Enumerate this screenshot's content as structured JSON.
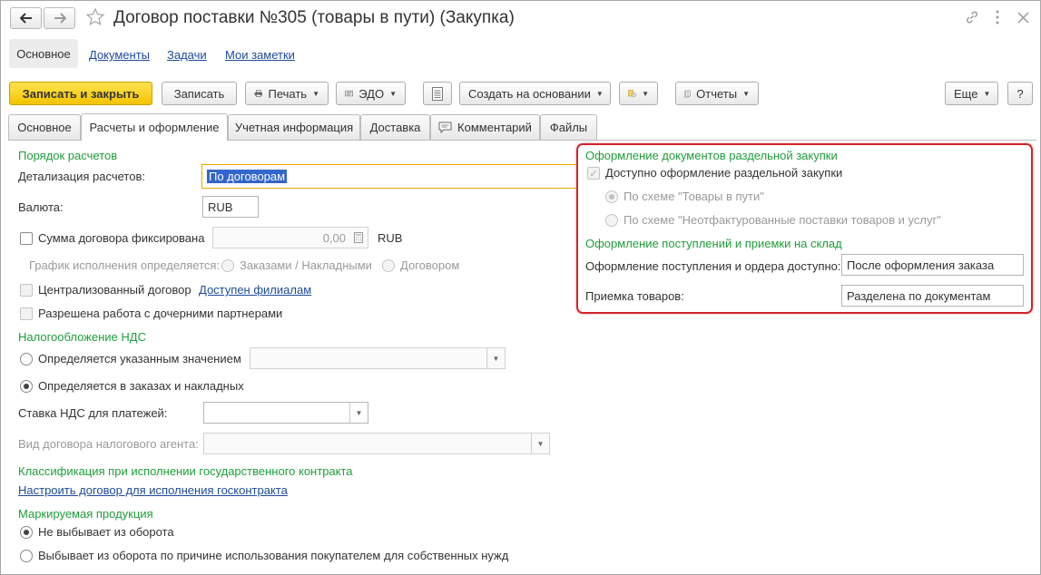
{
  "header": {
    "title": "Договор поставки №305 (товары в пути) (Закупка)",
    "back_icon": "arrow-left",
    "forward_icon": "arrow-right",
    "favorite_icon": "star",
    "link_icon": "chain-link",
    "more_icon": "vertical-dots",
    "close_icon": "close-x"
  },
  "nav": {
    "main": "Основное",
    "documents": "Документы",
    "tasks": "Задачи",
    "notes": "Мои заметки"
  },
  "toolbar": {
    "save_close": "Записать и закрыть",
    "save": "Записать",
    "print": "Печать",
    "edo": "ЭДО",
    "create_based": "Создать на основании",
    "reports": "Отчеты",
    "more": "Еще",
    "help": "?"
  },
  "tabs": [
    {
      "label": "Основное"
    },
    {
      "label": "Расчеты и оформление"
    },
    {
      "label": "Учетная информация"
    },
    {
      "label": "Доставка"
    },
    {
      "label": "Комментарий"
    },
    {
      "label": "Файлы"
    }
  ],
  "left": {
    "section_payment": "Порядок расчетов",
    "detail_label": "Детализация расчетов:",
    "detail_value": "По договорам",
    "currency_label": "Валюта:",
    "currency_value": "RUB",
    "fixed_sum_label": "Сумма договора фиксирована",
    "fixed_sum_value": "0,00",
    "fixed_sum_currency": "RUB",
    "schedule_label": "График исполнения определяется:",
    "schedule_option1": "Заказами / Накладными",
    "schedule_option2": "Договором",
    "centralized_label": "Централизованный договор",
    "branches_link": "Доступен филиалам",
    "subsidiaries_label": "Разрешена работа с дочерними партнерами",
    "section_vat": "Налогообложение НДС",
    "vat_option1": "Определяется указанным значением",
    "vat_option2": "Определяется в заказах и накладных",
    "vat_rate_label": "Ставка НДС для платежей:",
    "agent_label": "Вид договора налогового агента:",
    "section_gov": "Классификация при исполнении государственного контракта",
    "gov_link": "Настроить договор для исполнения госконтракта",
    "section_marked": "Маркируемая продукция",
    "marked_option1": "Не выбывает из оборота",
    "marked_option2": "Выбывает из оборота по причине использования покупателем для собственных нужд"
  },
  "right": {
    "section_separate": "Оформление документов раздельной закупки",
    "separate_available": "Доступно оформление раздельной закупки",
    "scheme1": "По схеме \"Товары в пути\"",
    "scheme2": "По схеме \"Неотфактурованные поставки товаров и услуг\"",
    "section_receipt": "Оформление поступлений и приемки на склад",
    "receipt_label": "Оформление поступления и ордера доступно:",
    "receipt_value": "После оформления заказа",
    "acceptance_label": "Приемка товаров:",
    "acceptance_value": "Разделена по документам"
  },
  "colors": {
    "section_green": "#1f9e3a",
    "primary_button": "#f5c800",
    "highlight_red": "#d2232a",
    "link_blue": "#1e4a9a",
    "selection_blue": "#3366cc"
  }
}
